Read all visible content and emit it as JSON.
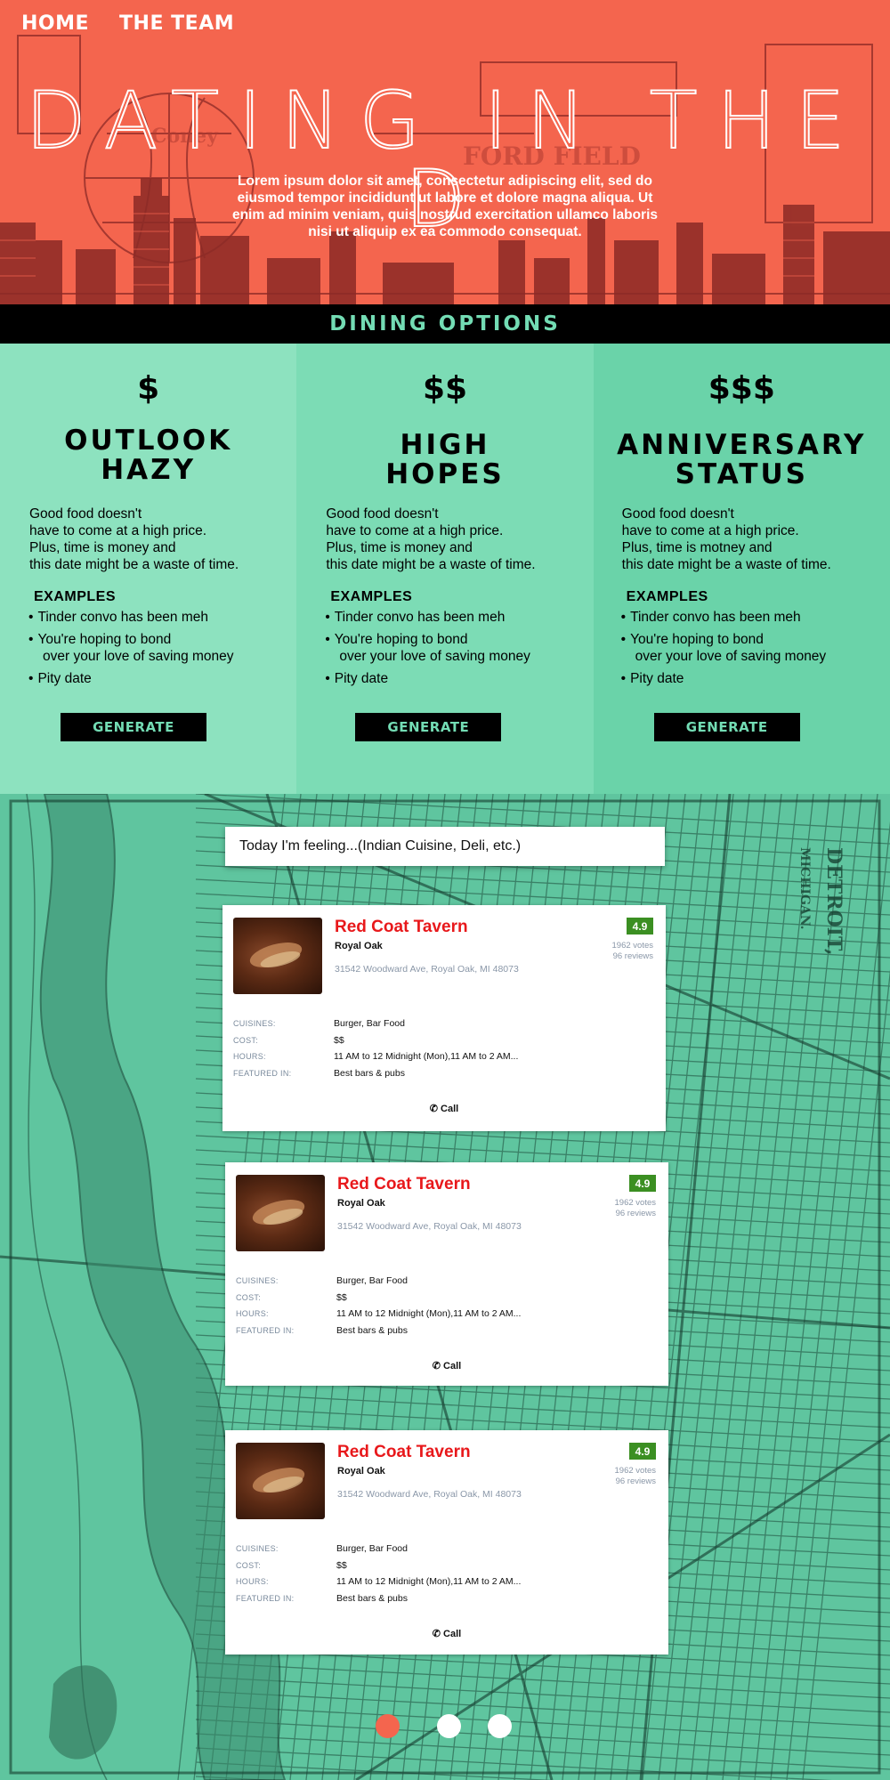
{
  "nav": {
    "home": "HOME",
    "team": "THE TEAM"
  },
  "hero": {
    "title": "DATING IN THE D",
    "body": "Lorem ipsum dolor sit amet, consectetur adipiscing elit, sed do eiusmod tempor incididunt ut labore et dolore magna aliqua. Ut enim ad minim veniam, quis nostrud exercitation ullamco laboris nisi ut aliquip ex ea commodo consequat."
  },
  "dining": {
    "heading": "DINING OPTIONS",
    "tiers": [
      {
        "price": "$",
        "name_line1": "OUTLOOK",
        "name_line2": "HAZY",
        "desc": [
          "Good food doesn't",
          "have to come at a high price.",
          "Plus, time is money and",
          "this date might be a waste of time."
        ],
        "examples_title": "EXAMPLES",
        "examples": [
          "Tinder convo has been meh",
          "You're hoping to bond",
          "over your love of saving money",
          "Pity date"
        ],
        "button": "GENERATE"
      },
      {
        "price": "$$",
        "name_line1": "HIGH",
        "name_line2": "HOPES",
        "desc": [
          "Good food doesn't",
          "have to come at a high price.",
          "Plus, time is money and",
          "this date might be a waste of time."
        ],
        "examples_title": "EXAMPLES",
        "examples": [
          "Tinder convo has been meh",
          "You're hoping to bond",
          "over your love of saving money",
          "Pity date"
        ],
        "button": "GENERATE"
      },
      {
        "price": "$$$",
        "name_line1": "ANNIVERSARY",
        "name_line2": "STATUS",
        "desc": [
          "Good food doesn't",
          "have to come at a high price.",
          "Plus, time is motney and",
          "this date might be a waste of time."
        ],
        "examples_title": "EXAMPLES",
        "examples": [
          "Tinder convo has been meh",
          "You're hoping to bond",
          "over your love of saving money",
          "Pity date"
        ],
        "button": "GENERATE"
      }
    ]
  },
  "search": {
    "text": "Today I'm feeling...(Indian Cuisine, Deli, etc.)"
  },
  "restaurants": [
    {
      "name": "Red Coat Tavern",
      "area": "Royal Oak",
      "address": "31542 Woodward Ave, Royal Oak, MI 48073",
      "rating": "4.9",
      "votes": "1962 votes",
      "reviews": "96 reviews",
      "labels": {
        "cuisines": "CUISINES:",
        "cost": "COST:",
        "hours": "HOURS:",
        "featured": "FEATURED IN:"
      },
      "cuisines": "Burger, Bar Food",
      "cost": "$$",
      "hours": "11 AM to 12 Midnight (Mon),11 AM to 2 AM...",
      "featured": "Best bars & pubs",
      "call": "Call"
    },
    {
      "name": "Red Coat Tavern",
      "area": "Royal Oak",
      "address": "31542 Woodward Ave, Royal Oak, MI 48073",
      "rating": "4.9",
      "votes": "1962 votes",
      "reviews": "96 reviews",
      "labels": {
        "cuisines": "CUISINES:",
        "cost": "COST:",
        "hours": "HOURS:",
        "featured": "FEATURED IN:"
      },
      "cuisines": "Burger, Bar Food",
      "cost": "$$",
      "hours": "11 AM to 12 Midnight (Mon),11 AM to 2 AM...",
      "featured": "Best bars & pubs",
      "call": "Call"
    },
    {
      "name": "Red Coat Tavern",
      "area": "Royal Oak",
      "address": "31542 Woodward Ave, Royal Oak, MI 48073",
      "rating": "4.9",
      "votes": "1962 votes",
      "reviews": "96 reviews",
      "labels": {
        "cuisines": "CUISINES:",
        "cost": "COST:",
        "hours": "HOURS:",
        "featured": "FEATURED IN:"
      },
      "cuisines": "Burger, Bar Food",
      "cost": "$$",
      "hours": "11 AM to 12 Midnight (Mon),11 AM to 2 AM...",
      "featured": "Best bars & pubs",
      "call": "Call"
    }
  ],
  "pagination": {
    "pages": 3,
    "active_index": 0
  },
  "colors": {
    "coral": "#f4654e",
    "mint": "#73dcb4",
    "rating_green": "#3b8f22",
    "name_red": "#e8181b"
  },
  "icons": {
    "phone": "phone-icon"
  }
}
